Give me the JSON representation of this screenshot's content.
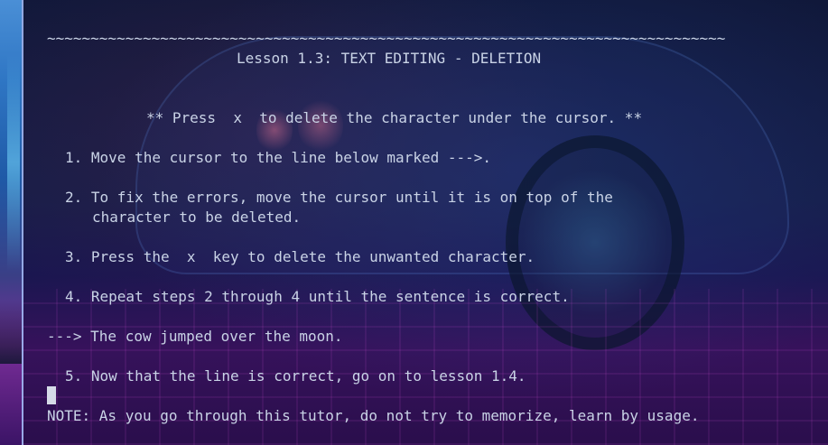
{
  "tutor": {
    "separator": "~~~~~~~~~~~~~~~~~~~~~~~~~~~~~~~~~~~~~~~~~~~~~~~~~~~~~~~~~~~~~~~~~~~~~~~~~~~~~~",
    "title": "Lesson 1.3: TEXT EDITING - DELETION",
    "instruction": "** Press  x  to delete the character under the cursor. **",
    "steps": [
      "1. Move the cursor to the line below marked --->.",
      "2. To fix the errors, move the cursor until it is on top of the",
      "character to be deleted.",
      "3. Press the  x  key to delete the unwanted character.",
      "4. Repeat steps 2 through 4 until the sentence is correct."
    ],
    "practice_line": "---> The cow jumped over the moon.",
    "step5": "5. Now that the line is correct, go on to lesson 1.4.",
    "note": "NOTE: As you go through this tutor, do not try to memorize, learn by usage."
  }
}
